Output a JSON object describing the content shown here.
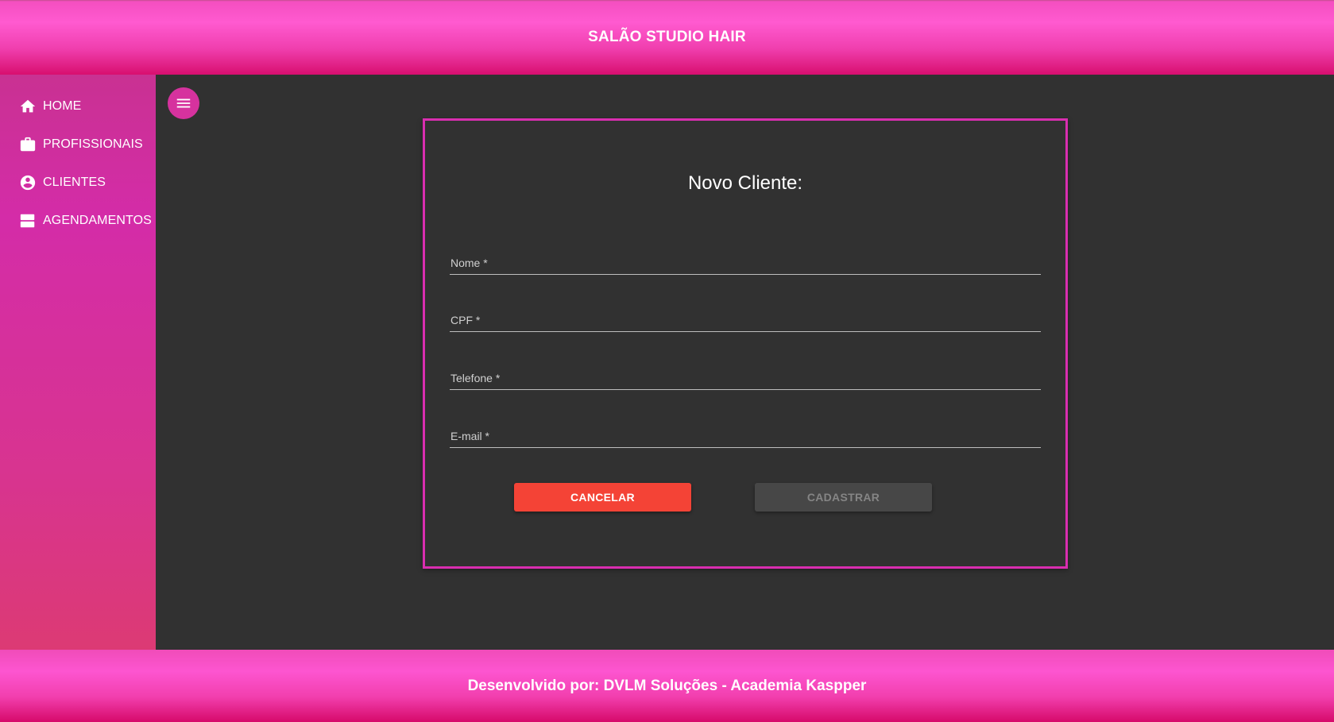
{
  "header": {
    "title": "SALÃO STUDIO HAIR"
  },
  "sidebar": {
    "items": [
      {
        "label": "HOME",
        "icon": "home-icon"
      },
      {
        "label": "PROFISSIONAIS",
        "icon": "briefcase-icon"
      },
      {
        "label": "CLIENTES",
        "icon": "account-circle-icon"
      },
      {
        "label": "AGENDAMENTOS",
        "icon": "view-agenda-icon"
      }
    ]
  },
  "main": {
    "menu_icon": "menu-icon",
    "form": {
      "title": "Novo Cliente:",
      "fields": [
        {
          "label": "Nome *",
          "value": ""
        },
        {
          "label": "CPF *",
          "value": ""
        },
        {
          "label": "Telefone *",
          "value": ""
        },
        {
          "label": "E-mail *",
          "value": ""
        }
      ],
      "cancel_label": "CANCELAR",
      "submit_label": "CADASTRAR"
    }
  },
  "footer": {
    "text": "Desenvolvido por: DVLM Soluções - Academia Kaspper"
  },
  "colors": {
    "accent": "#d92eb0",
    "header_pink": "#ff5ad0",
    "cancel_red": "#f44336",
    "background_dark": "#313131",
    "disabled_button": "#474747"
  }
}
